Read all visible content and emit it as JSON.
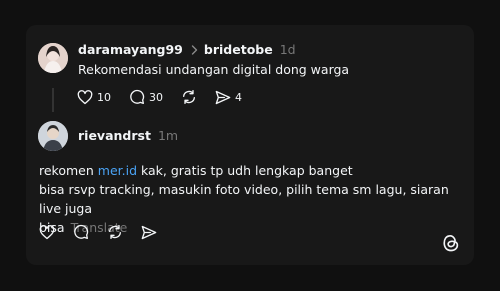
{
  "post": {
    "username": "daramayang99",
    "reply_to": "bridetobe",
    "time": "1d",
    "text": "Rekomendasi undangan digital dong warga",
    "likes": "10",
    "comments": "30",
    "shares": "4"
  },
  "reply": {
    "username": "rievandrst",
    "time": "1m",
    "line1_before": "rekomen ",
    "mention": "mer.id",
    "line1_after": " kak, gratis tp udh lengkap banget",
    "line2": "bisa rsvp tracking, masukin foto video, pilih tema sm lagu, siaran live juga",
    "line3": "bisa",
    "translate_label": "Translate"
  },
  "icons": {
    "like": "heart-icon",
    "comment": "comment-icon",
    "repost": "repost-icon",
    "share": "send-icon",
    "logo": "threads-logo-icon"
  },
  "colors": {
    "background": "#101010",
    "card": "#181818",
    "mention": "#4aa3f5",
    "muted": "#777777"
  }
}
